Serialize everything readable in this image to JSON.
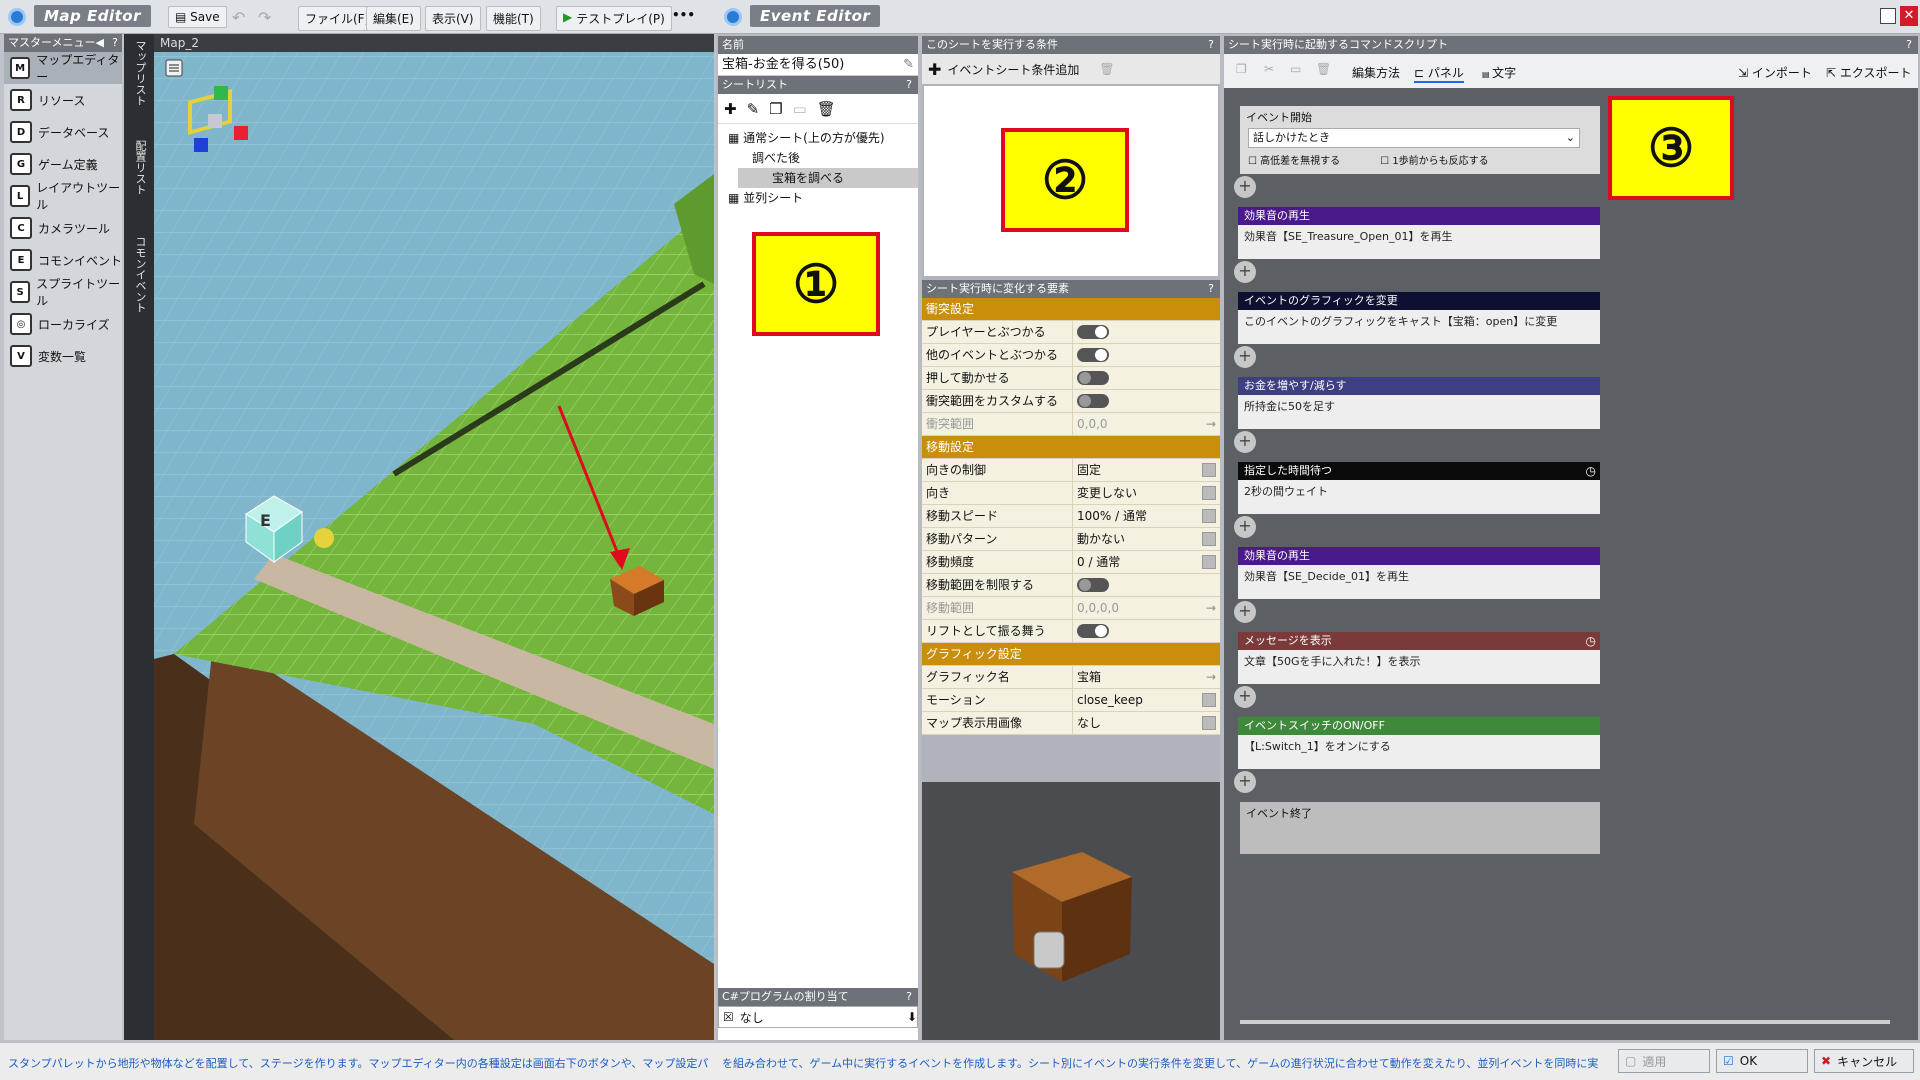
{
  "map_editor": {
    "title": "Map Editor",
    "toolbar": {
      "save": "Save",
      "menus": [
        "ファイル(F)",
        "編集(E)",
        "表示(V)",
        "機能(T)"
      ],
      "testplay": "テストプレイ(P)",
      "more": "•••"
    },
    "master_menu": {
      "title": "マスターメニュー",
      "items": [
        {
          "label": "マップエディター",
          "icon": "M"
        },
        {
          "label": "リソース",
          "icon": "R"
        },
        {
          "label": "データベース",
          "icon": "D"
        },
        {
          "label": "ゲーム定義",
          "icon": "G"
        },
        {
          "label": "レイアウトツール",
          "icon": "L"
        },
        {
          "label": "カメラツール",
          "icon": "C"
        },
        {
          "label": "コモンイベント",
          "icon": "E"
        },
        {
          "label": "スプライトツール",
          "icon": "S"
        },
        {
          "label": "ローカライズ",
          "icon": "◎"
        },
        {
          "label": "変数一覧",
          "icon": "V"
        }
      ]
    },
    "vertical_tabs": [
      "マップリスト",
      "配置リスト",
      "コモンイベント"
    ],
    "map_tab": "Map_2"
  },
  "status_text": "スタンプパレットから地形や物体などを配置して、ステージを作ります。マップエディター内の各種設定は画面右下のボタンや、マップ設定パレッ",
  "event_editor": {
    "title": "Event Editor",
    "name_header": "名前",
    "name_value": "宝箱-お金を得る(50)",
    "sheet_list_header": "シートリスト",
    "sheets": [
      {
        "label": "通常シート(上の方が優先)"
      },
      {
        "label": "調べた後"
      },
      {
        "label": "宝箱を調べる"
      },
      {
        "label": "並列シート"
      }
    ],
    "csharp_header": "C#プログラムの割り当て",
    "csharp_value": "なし",
    "conditions_header": "このシートを実行する条件",
    "add_condition": "イベントシート条件追加",
    "props_header": "シート実行時に変化する要素",
    "props": [
      {
        "type": "sec",
        "label": "衝突設定"
      },
      {
        "type": "toggle",
        "label": "プレイヤーとぶつかる",
        "state": "on"
      },
      {
        "type": "toggle",
        "label": "他のイベントとぶつかる",
        "state": "on"
      },
      {
        "type": "toggle",
        "label": "押して動かせる",
        "state": "off"
      },
      {
        "type": "toggle",
        "label": "衝突範囲をカスタムする",
        "state": "off"
      },
      {
        "type": "arrow",
        "label": "衝突範囲",
        "value": "0,0,0",
        "disabled": true
      },
      {
        "type": "sec",
        "label": "移動設定"
      },
      {
        "type": "dd",
        "label": "向きの制御",
        "value": "固定"
      },
      {
        "type": "dd",
        "label": "向き",
        "value": "変更しない"
      },
      {
        "type": "dd",
        "label": "移動スピード",
        "value": "100% / 通常"
      },
      {
        "type": "dd",
        "label": "移動パターン",
        "value": "動かない"
      },
      {
        "type": "dd",
        "label": "移動頻度",
        "value": "0 / 通常"
      },
      {
        "type": "toggle",
        "label": "移動範囲を制限する",
        "state": "off"
      },
      {
        "type": "arrow",
        "label": "移動範囲",
        "value": "0,0,0,0",
        "disabled": true
      },
      {
        "type": "toggle",
        "label": "リフトとして振る舞う",
        "state": "on"
      },
      {
        "type": "sec",
        "label": "グラフィック設定"
      },
      {
        "type": "arrow",
        "label": "グラフィック名",
        "value": "宝箱"
      },
      {
        "type": "dd",
        "label": "モーション",
        "value": "close_keep"
      },
      {
        "type": "dd",
        "label": "マップ表示用画像",
        "value": "なし"
      }
    ],
    "script_header": "シート実行時に起動するコマンドスクリプト",
    "edit_method": "編集方法",
    "panel_label": "パネル",
    "text_label": "文字",
    "import_label": "インポート",
    "export_label": "エクスポート",
    "event_start": {
      "title": "イベント開始",
      "trigger": "話しかけたとき",
      "check1": "高低差を無視する",
      "check2": "1歩前からも反応する"
    },
    "commands": [
      {
        "title": "効果音の再生",
        "body": "効果音【SE_Treasure_Open_01】を再生",
        "color": "#4b1a8a",
        "clock": false
      },
      {
        "title": "イベントのグラフィックを変更",
        "body": "このイベントのグラフィックをキャスト【宝箱：open】に変更",
        "color": "#0d1030",
        "clock": false
      },
      {
        "title": "お金を増やす/減らす",
        "body": "所持金に50を足す",
        "color": "#3d3f82",
        "clock": false
      },
      {
        "title": "指定した時間待つ",
        "body": "2秒の間ウェイト",
        "color": "#0a0a0a",
        "clock": true
      },
      {
        "title": "効果音の再生",
        "body": "効果音【SE_Decide_01】を再生",
        "color": "#4b1a8a",
        "clock": false
      },
      {
        "title": "メッセージを表示",
        "body": "文章【50Gを手に入れた！】を表示",
        "color": "#7a3a3a",
        "clock": true
      },
      {
        "title": "イベントスイッチのON/OFF",
        "body": "【L:Switch_1】をオンにする",
        "color": "#3e8a3a",
        "clock": false
      }
    ],
    "event_end": "イベント終了",
    "bottom_text": "を組み合わせて、ゲーム中に実行するイベントを作成します。シート別にイベントの実行条件を変更して、ゲームの進行状況に合わせて動作を変えたり、並列イベントを同時に実",
    "buttons": {
      "apply": "適用",
      "ok": "OK",
      "cancel": "キャンセル"
    }
  },
  "markers": [
    "①",
    "②",
    "③"
  ]
}
